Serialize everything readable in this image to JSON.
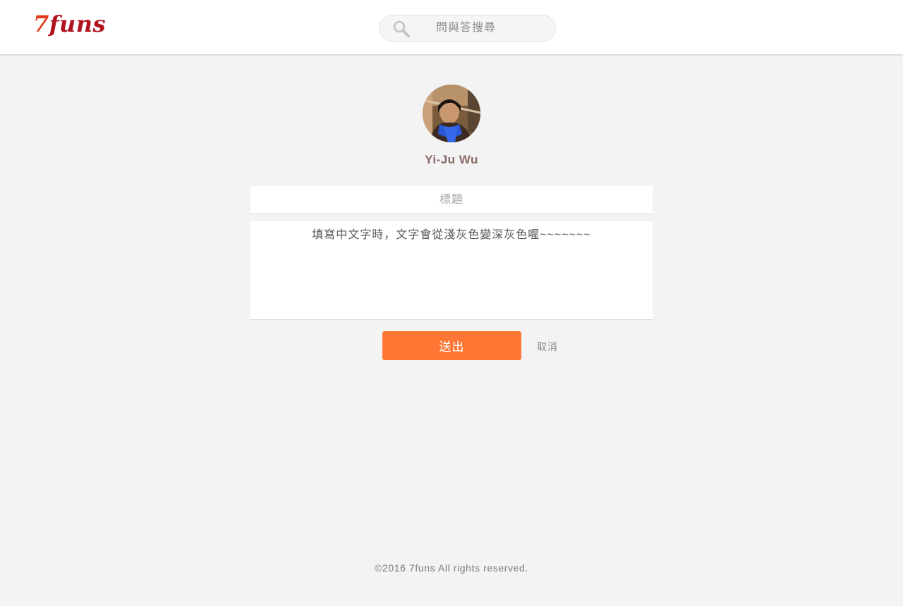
{
  "header": {
    "logo_number": "7",
    "logo_word": "funs",
    "search_placeholder": "問與答搜尋"
  },
  "profile": {
    "name": "Yi-Ju Wu"
  },
  "form": {
    "title_placeholder": "標題",
    "body_value": "填寫中文字時，文字會從淺灰色變深灰色喔~~~~~~~",
    "submit_label": "送出",
    "cancel_label": "取消"
  },
  "footer": {
    "copyright": "©2016 7funs All rights reserved."
  },
  "colors": {
    "brand_orange": "#ff7533",
    "logo_red": "#b0131d",
    "background": "#f3f3f3"
  },
  "icons": {
    "search": "search-icon",
    "avatar": "user-avatar"
  }
}
